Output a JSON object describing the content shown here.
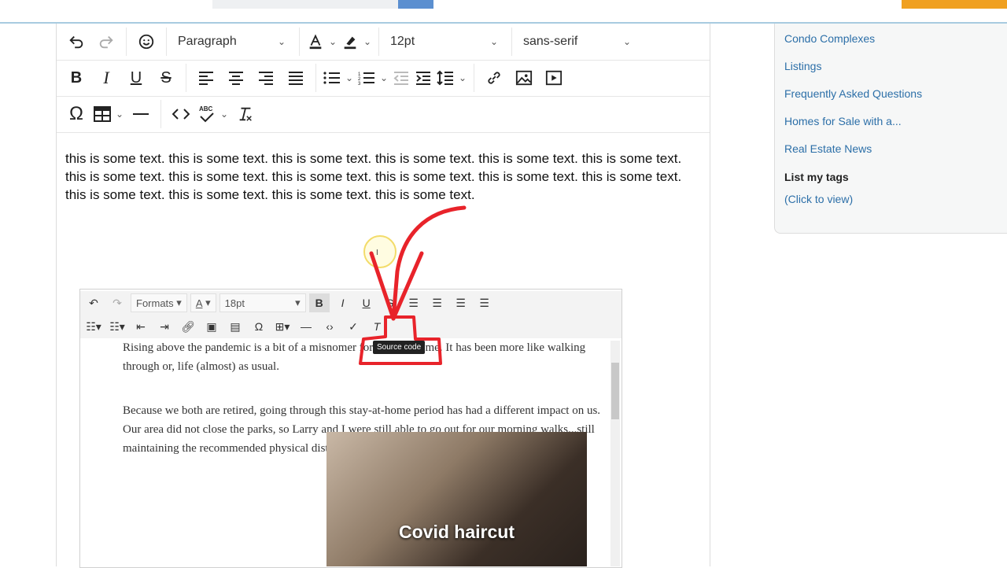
{
  "toolbar": {
    "row1": {
      "undo_icon": "undo-icon",
      "redo_icon": "redo-icon",
      "emoji_icon": "emoji-icon",
      "block_format": "Paragraph",
      "font_size": "12pt",
      "font_family": "sans-serif"
    },
    "row2_icons": [
      "bold-icon",
      "italic-icon",
      "underline-icon",
      "strikethrough-icon",
      "align-left-icon",
      "align-center-icon",
      "align-right-icon",
      "justify-icon",
      "bullet-list-icon",
      "numbered-list-icon",
      "outdent-icon",
      "indent-icon",
      "line-height-icon",
      "link-icon",
      "image-icon",
      "media-icon"
    ],
    "row3_icons": [
      "special-character-icon",
      "table-icon",
      "horizontal-rule-icon",
      "source-code-icon",
      "spellcheck-icon",
      "clear-formatting-icon"
    ]
  },
  "editor": {
    "content": "this is some text. this is some text. this is some text. this is some text. this is some text. this is some text. this is some text. this is some text. this is some text. this is some text. this is some text. this is some text. this is some text. this is some text. this is some text. this is some text."
  },
  "sidebar": {
    "links": [
      "Condo Complexes",
      "Listings",
      "Frequently Asked Questions",
      "Homes for Sale with a...",
      "Real Estate News"
    ],
    "tags_heading": "List my tags",
    "tags_link": "(Click to view)"
  },
  "inner_editor": {
    "formats_label": "Formats",
    "font_size": "18pt",
    "tooltip": "Source code",
    "paragraph1": "Rising above the pandemic is a bit of a misnomer for Larry and me. It has been more like walking through or, life (almost) as usual.",
    "paragraph2": "Because we both are retired, going through this stay-at-home period has had a different impact on us. Our area did not close the parks, so Larry and I were still able to go out for our morning walks...still maintaining the recommended physical distance from others.",
    "photo_caption": "Covid haircut"
  },
  "colors": {
    "link": "#2c6fa8",
    "annotation": "#e8232a",
    "logo": "#f0a020"
  }
}
